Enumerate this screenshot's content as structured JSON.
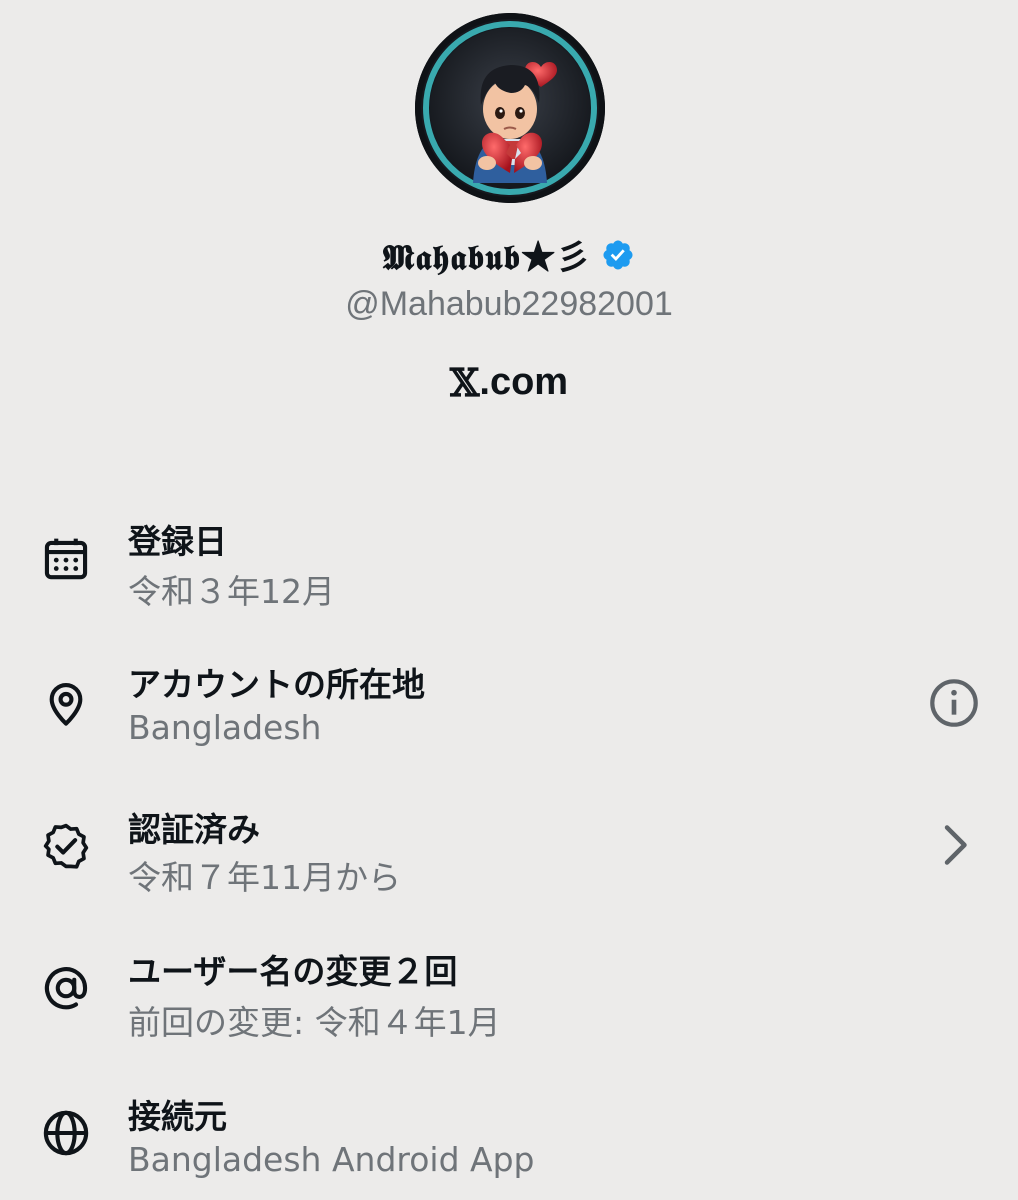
{
  "profile": {
    "display_name": "𝕸𝖆𝖍𝖆𝖇𝖚𝖇★彡",
    "handle": "@Mahabub22982001",
    "site": {
      "x_glyph": "𝕏",
      "suffix": ".com"
    },
    "avatar_icon": "boy-holding-broken-heart-avatar",
    "verified_icon": "verified-badge-icon",
    "verified_color": "#1d9bf0"
  },
  "info_rows": [
    {
      "icon": "calendar-icon",
      "title": "登録日",
      "value": "令和３年12月"
    },
    {
      "icon": "location-pin-icon",
      "title": "アカウントの所在地",
      "value": "Bangladesh",
      "trailing_icon": "info-icon"
    },
    {
      "icon": "verified-check-icon",
      "title": "認証済み",
      "value": "令和７年11月から",
      "trailing_icon": "chevron-right-icon"
    },
    {
      "icon": "at-sign-icon",
      "title": "ユーザー名の変更２回",
      "value": "前回の変更: 令和４年1月"
    },
    {
      "icon": "globe-icon",
      "title": "接続元",
      "value": "Bangladesh Android App"
    }
  ],
  "colors": {
    "background": "#ecebea",
    "primary_text": "#0f1419",
    "secondary_text": "#6f7479",
    "avatar_ring": "#3fc4c9"
  }
}
